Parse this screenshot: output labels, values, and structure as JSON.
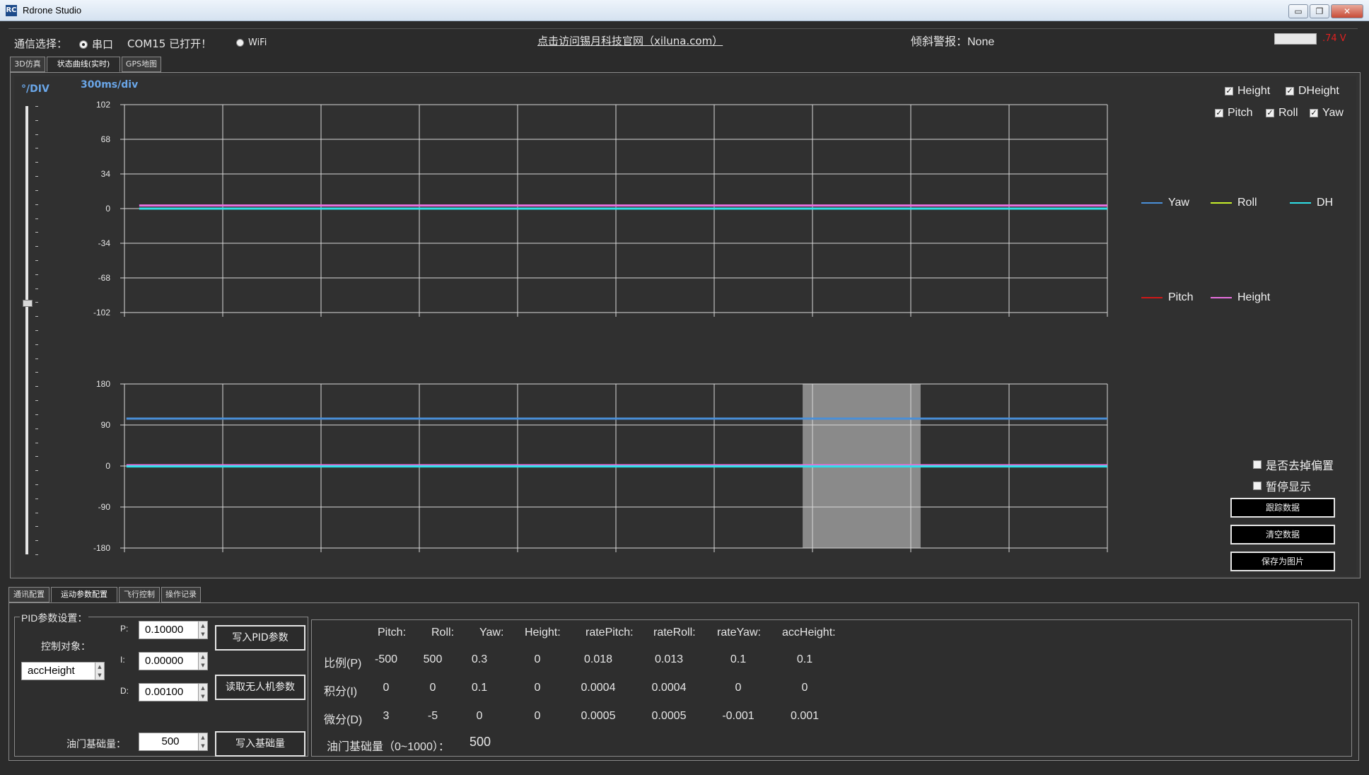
{
  "window": {
    "title": "Rdrone Studio",
    "icon_label": "RC",
    "buttons": {
      "minimize": "▭",
      "restore": "❐",
      "close": "✕"
    }
  },
  "topbar": {
    "comm_label": "通信选择：",
    "serial_label": "串口",
    "serial_status": "COM15 已打开！",
    "wifi_label": "WiFi",
    "website_link": "点击访问锡月科技官网（xiluna.com）",
    "tilt_alarm": "倾斜警报：None",
    "voltage": ".74 V",
    "battery_level": 1.0
  },
  "top_tabs": [
    {
      "label": "3D仿真"
    },
    {
      "label": "状态曲线(实时)"
    },
    {
      "label": "GPS地图"
    }
  ],
  "chart_header": {
    "y_unit": "°/DIV",
    "x_unit": "300ms/div"
  },
  "series_checkboxes": [
    {
      "label": "Height",
      "checked": true
    },
    {
      "label": "DHeight",
      "checked": true
    },
    {
      "label": "Pitch",
      "checked": true
    },
    {
      "label": "Roll",
      "checked": true
    },
    {
      "label": "Yaw",
      "checked": true
    }
  ],
  "legend": [
    {
      "name": "Yaw",
      "color": "#4a8fd8"
    },
    {
      "name": "Roll",
      "color": "#c8f02a"
    },
    {
      "name": "DH",
      "color": "#2fe0e8"
    },
    {
      "name": "Pitch",
      "color": "#d01818"
    },
    {
      "name": "Height",
      "color": "#e870e0"
    }
  ],
  "chart_data": [
    {
      "type": "line",
      "y_ticks": [
        "102",
        "68",
        "34",
        "0",
        "-34",
        "-68",
        "-102"
      ],
      "ylim": [
        -102,
        102
      ],
      "x_divisions": 10,
      "grid": true,
      "series": [
        {
          "name": "Height",
          "color": "#e870e0",
          "x": [
            0.15,
            10
          ],
          "values": [
            3,
            3
          ]
        },
        {
          "name": "DH",
          "color": "#2fe0e8",
          "x": [
            0.15,
            10
          ],
          "values": [
            0,
            0
          ]
        }
      ]
    },
    {
      "type": "line",
      "y_ticks": [
        "180",
        "90",
        "0",
        "-90",
        "-180"
      ],
      "ylim": [
        -180,
        180
      ],
      "x_divisions": 10,
      "grid": true,
      "highlight_x": [
        6.9,
        8.1
      ],
      "series": [
        {
          "name": "Yaw",
          "color": "#4a8fd8",
          "x": [
            0.02,
            10
          ],
          "values": [
            104,
            104
          ]
        },
        {
          "name": "Height",
          "color": "#e870e0",
          "x": [
            0.02,
            10
          ],
          "values": [
            1.5,
            1.5
          ]
        },
        {
          "name": "DH",
          "color": "#2fe0e8",
          "x": [
            0.02,
            10
          ],
          "values": [
            -1,
            -1
          ]
        }
      ]
    }
  ],
  "right_controls": {
    "remove_offset": "是否去掉偏置",
    "pause_display": "暂停显示",
    "track_data": "跟踪数据",
    "clear_data": "清空数据",
    "save_image": "保存为图片"
  },
  "bottom_tabs": [
    {
      "label": "通讯配置"
    },
    {
      "label": "运动参数配置"
    },
    {
      "label": "飞行控制"
    },
    {
      "label": "操作记录"
    }
  ],
  "pid": {
    "group_label": "PID参数设置：",
    "control_target_label": "控制对象：",
    "control_target_value": "accHeight",
    "p_label": "P:",
    "p_value": "0.10000",
    "i_label": "I:",
    "i_value": "0.00000",
    "d_label": "D:",
    "d_value": "0.00100",
    "write_pid": "写入PID参数",
    "read_drone": "读取无人机参数",
    "throttle_label": "油门基础量：",
    "throttle_value": "500",
    "write_base": "写入基础量"
  },
  "param_table": {
    "headers": [
      "Pitch:",
      "Roll:",
      "Yaw:",
      "Height:",
      "ratePitch:",
      "rateRoll:",
      "rateYaw:",
      "accHeight:"
    ],
    "rows": [
      {
        "label": "比例(P)",
        "values": [
          "-500",
          "500",
          "0.3",
          "0",
          "0.018",
          "0.013",
          "0.1",
          "0.1"
        ]
      },
      {
        "label": "积分(I)",
        "values": [
          "0",
          "0",
          "0.1",
          "0",
          "0.0004",
          "0.0004",
          "0",
          "0"
        ]
      },
      {
        "label": "微分(D)",
        "values": [
          "3",
          "-5",
          "0",
          "0",
          "0.0005",
          "0.0005",
          "-0.001",
          "0.001"
        ]
      }
    ],
    "throttle_range_label": "油门基础量（0~1000）：",
    "throttle_value": "500"
  }
}
